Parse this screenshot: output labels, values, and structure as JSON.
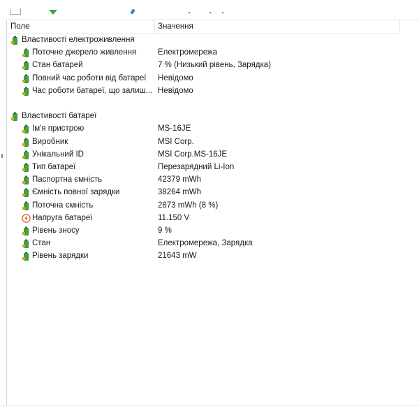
{
  "colors": {
    "battery_green": "#3aa83a",
    "battery_dark": "#2f6f2f",
    "bolt_orange": "#e8501c"
  },
  "header": {
    "field": "Поле",
    "value": "Значення"
  },
  "groups": [
    {
      "title": "Властивості електроживлення",
      "icon": "battery-icon",
      "rows": [
        {
          "label": "Поточне джерело живлення",
          "value": "Електромережа",
          "icon": "battery-icon"
        },
        {
          "label": "Стан батарей",
          "value": "7 % (Низький рівень, Зарядка)",
          "icon": "battery-icon"
        },
        {
          "label": "Повний час роботи від батареї",
          "value": "Невідомо",
          "icon": "battery-icon"
        },
        {
          "label": "Час роботи батареї, що залиш...",
          "value": "Невідомо",
          "icon": "battery-icon"
        }
      ]
    },
    {
      "title": "Властивості батареї",
      "icon": "battery-icon",
      "rows": [
        {
          "label": "Ім'я пристрою",
          "value": "MS-16JE",
          "icon": "battery-icon"
        },
        {
          "label": "Виробник",
          "value": "MSI Corp.",
          "icon": "battery-icon"
        },
        {
          "label": "Унікальний ID",
          "value": "MSI Corp.MS-16JE",
          "icon": "battery-icon"
        },
        {
          "label": "Тип батареї",
          "value": "Перезарядний Li-Ion",
          "icon": "battery-icon"
        },
        {
          "label": "Паспортна ємність",
          "value": "42379 mWh",
          "icon": "battery-icon"
        },
        {
          "label": "Ємність повної зарядки",
          "value": "38264 mWh",
          "icon": "battery-icon"
        },
        {
          "label": "Поточна ємність",
          "value": "2873 mWh  (8 %)",
          "icon": "battery-icon"
        },
        {
          "label": "Напруга батареї",
          "value": "11.150 V",
          "icon": "lightning-icon"
        },
        {
          "label": "Рівень зносу",
          "value": "9 %",
          "icon": "battery-icon"
        },
        {
          "label": "Стан",
          "value": "Електромережа, Зарядка",
          "icon": "battery-icon"
        },
        {
          "label": "Рівень зарядки",
          "value": "21643 mW",
          "icon": "battery-icon"
        }
      ]
    }
  ]
}
